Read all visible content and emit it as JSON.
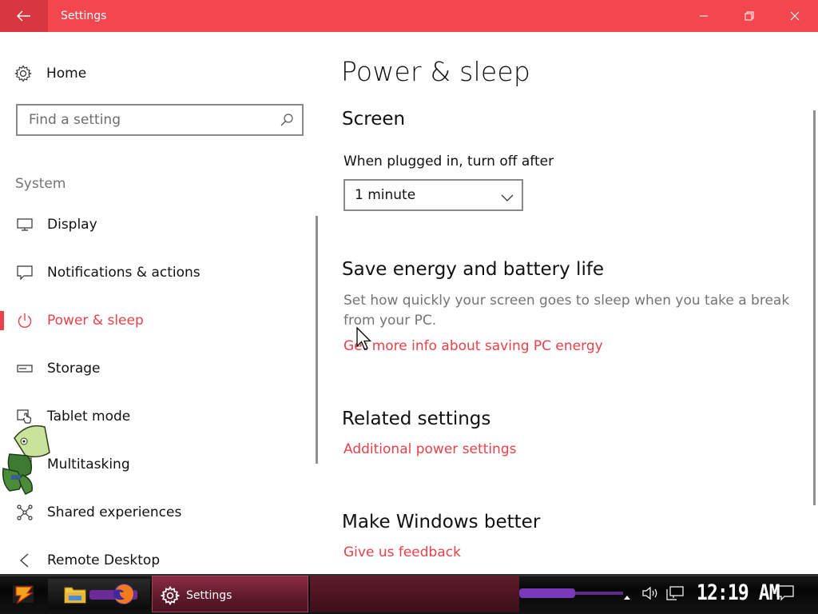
{
  "window": {
    "title": "Settings",
    "accent_color": "#e8414a",
    "titlebar_color": "#f2474f"
  },
  "sidebar": {
    "home_label": "Home",
    "search_placeholder": "Find a setting",
    "section_label": "System",
    "items": [
      {
        "label": "Display",
        "icon": "display-icon",
        "active": false
      },
      {
        "label": "Notifications & actions",
        "icon": "notifications-icon",
        "active": false
      },
      {
        "label": "Power & sleep",
        "icon": "power-icon",
        "active": true
      },
      {
        "label": "Storage",
        "icon": "storage-icon",
        "active": false
      },
      {
        "label": "Tablet mode",
        "icon": "tablet-mode-icon",
        "active": false
      },
      {
        "label": "Multitasking",
        "icon": "multitasking-icon",
        "active": false
      },
      {
        "label": "Shared experiences",
        "icon": "shared-experiences-icon",
        "active": false
      },
      {
        "label": "Remote Desktop",
        "icon": "remote-desktop-icon",
        "active": false
      }
    ]
  },
  "main": {
    "title": "Power & sleep",
    "screen": {
      "heading": "Screen",
      "label": "When plugged in, turn off after",
      "selected": "1 minute"
    },
    "save_energy": {
      "heading": "Save energy and battery life",
      "description": "Set how quickly your screen goes to sleep when you take a break from your PC.",
      "link": "Get more info about saving PC energy"
    },
    "related": {
      "heading": "Related settings",
      "link": "Additional power settings"
    },
    "feedback": {
      "heading": "Make Windows better",
      "link": "Give us feedback"
    }
  },
  "taskbar": {
    "active_app": "Settings",
    "clock": "12:19 AM"
  }
}
